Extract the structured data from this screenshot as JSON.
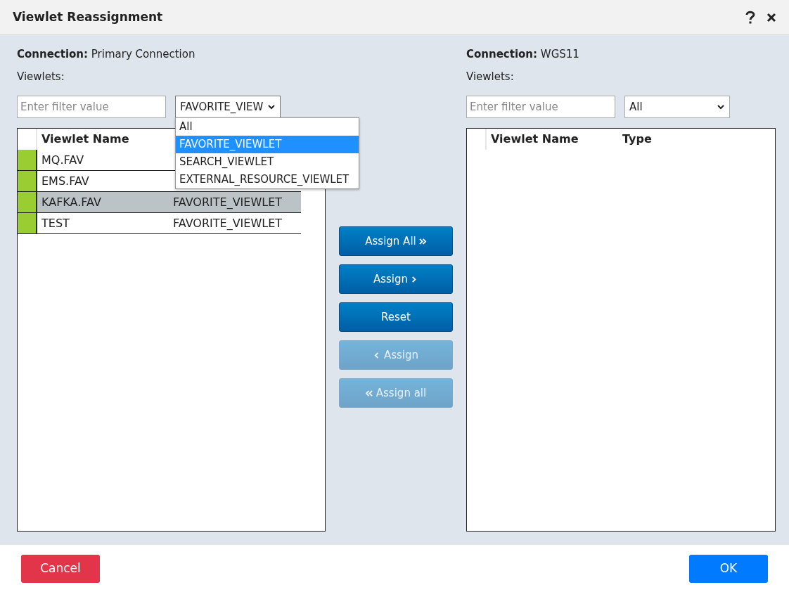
{
  "window": {
    "title": "Viewlet Reassignment"
  },
  "left": {
    "connection_label": "Connection:",
    "connection": "Primary Connection",
    "viewlets_label": "Viewlets:",
    "filter": {
      "placeholder": "Enter filter value"
    },
    "type_filter": {
      "value": "FAVORITE_VIEW",
      "expanded": true,
      "options": [
        {
          "label": "All",
          "selected": false
        },
        {
          "label": "FAVORITE_VIEWLET",
          "selected": true
        },
        {
          "label": "SEARCH_VIEWLET",
          "selected": false
        },
        {
          "label": "EXTERNAL_RESOURCE_VIEWLET",
          "selected": false
        }
      ]
    },
    "columns": [
      "Viewlet Name"
    ],
    "rows": [
      {
        "name": "MQ.FAV",
        "selected": false
      },
      {
        "name": "EMS.FAV",
        "selected": false
      },
      {
        "name": "KAFKA.FAV",
        "type": "FAVORITE_VIEWLET",
        "selected": true
      },
      {
        "name": "TEST",
        "type": "FAVORITE_VIEWLET",
        "selected": false
      }
    ]
  },
  "actions": [
    {
      "label": "Assign All",
      "kind": "assign-all",
      "disabled": false
    },
    {
      "label": "Assign",
      "kind": "assign",
      "disabled": false
    },
    {
      "label": "Reset",
      "kind": "reset",
      "disabled": false
    },
    {
      "label": "Assign",
      "kind": "unassign",
      "disabled": true
    },
    {
      "label": "Assign all",
      "kind": "unassign-all",
      "disabled": true
    }
  ],
  "right": {
    "connection_label": "Connection:",
    "connection": "WGS11",
    "viewlets_label": "Viewlets:",
    "filter": {
      "placeholder": "Enter filter value"
    },
    "type_filter": {
      "value": "All",
      "expanded": false
    },
    "columns": [
      "Viewlet Name",
      "Type"
    ]
  },
  "footer": [
    {
      "label": "Cancel",
      "kind": "cancel"
    },
    {
      "label": "OK",
      "kind": "ok"
    }
  ]
}
